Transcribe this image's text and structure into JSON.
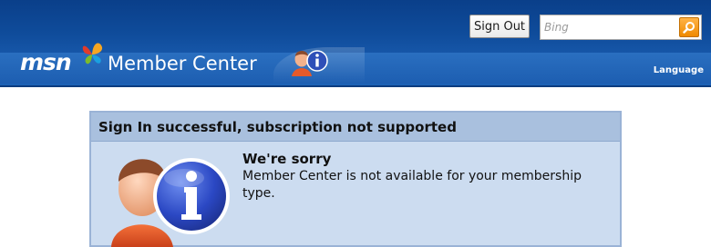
{
  "header": {
    "brand": "msn",
    "title": "Member Center",
    "sign_out_label": "Sign Out",
    "search_placeholder": "Bing",
    "search_value": "",
    "language_label": "Language",
    "icons": [
      "msn-butterfly-icon",
      "user-info-icon",
      "search-icon"
    ]
  },
  "dialog": {
    "title": "Sign In successful, subscription not supported",
    "heading": "We're sorry",
    "message": "Member Center is not available for your membership type.",
    "icon": "user-info-icon"
  },
  "colors": {
    "header_dark": "#0a3f8a",
    "header_band": "#2a6fc0",
    "dialog_title_bg": "#a9c0de",
    "dialog_body_bg": "#ccdcf0",
    "search_button": "#f08a00"
  }
}
